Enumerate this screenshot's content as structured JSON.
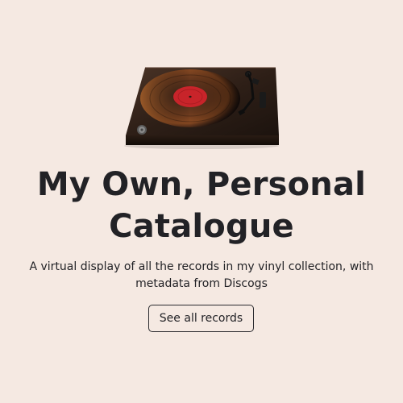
{
  "hero": {
    "image_icon": "turntable-illustration",
    "title": "My Own, Personal Catalogue",
    "subtitle": "A virtual display of all the records in my vinyl collection, with metadata from Discogs",
    "cta_label": "See all records"
  },
  "colors": {
    "background": "#f5e9e2",
    "text": "#222226",
    "record_label": "#c8242a"
  }
}
